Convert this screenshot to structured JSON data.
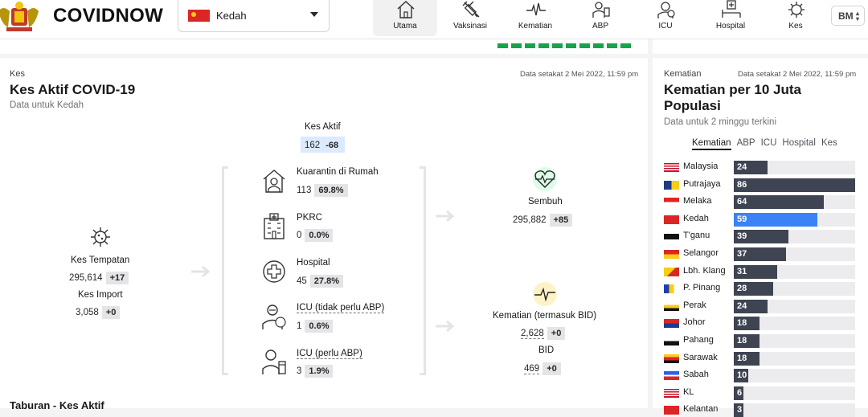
{
  "header": {
    "brand": "COVIDNOW",
    "state": "Kedah",
    "language": "BM",
    "nav": [
      {
        "label": "Utama",
        "icon": "home-icon",
        "active": true
      },
      {
        "label": "Vaksinasi",
        "icon": "syringe-icon",
        "active": false
      },
      {
        "label": "Kematian",
        "icon": "heartbeat-icon",
        "active": false
      },
      {
        "label": "ABP",
        "icon": "ventilator-icon",
        "active": false
      },
      {
        "label": "ICU",
        "icon": "icu-icon",
        "active": false
      },
      {
        "label": "Hospital",
        "icon": "hospital-bed-icon",
        "active": false
      },
      {
        "label": "Kes",
        "icon": "virus-icon",
        "active": false
      }
    ]
  },
  "cases": {
    "eyebrow": "Kes",
    "as_of": "Data setakat 2 Mei 2022, 11:59 pm",
    "title": "Kes Aktif COVID-19",
    "subtitle": "Data untuk Kedah",
    "local": {
      "label": "Kes Tempatan",
      "value": "295,614",
      "delta": "+17"
    },
    "import": {
      "label": "Kes Import",
      "value": "3,058",
      "delta": "+0"
    },
    "active": {
      "label": "Kes Aktif",
      "value": "162",
      "delta": "-68"
    },
    "breakdown": [
      {
        "label": "Kuarantin di Rumah",
        "value": "113",
        "pct": "69.8%",
        "icon": "home-quarantine-icon"
      },
      {
        "label": "PKRC",
        "value": "0",
        "pct": "0.0%",
        "icon": "pkrc-building-icon"
      },
      {
        "label": "Hospital",
        "value": "45",
        "pct": "27.8%",
        "icon": "hospital-cross-icon"
      },
      {
        "label": "ICU (tidak perlu ABP)",
        "value": "1",
        "pct": "0.6%",
        "icon": "icu-patient-icon"
      },
      {
        "label": "ICU (perlu ABP)",
        "value": "3",
        "pct": "1.9%",
        "icon": "ventilator-patient-icon"
      }
    ],
    "recovered": {
      "label": "Sembuh",
      "value": "295,882",
      "delta": "+85"
    },
    "deaths": {
      "label": "Kematian (termasuk BID)",
      "value": "2,628",
      "delta": "+0"
    },
    "bid": {
      "label": "BID",
      "value": "469",
      "delta": "+0"
    },
    "next_section": "Taburan - Kes Aktif"
  },
  "deaths_rank": {
    "eyebrow": "Kematian",
    "as_of": "Data setakat 2 Mei 2022, 11:59 pm",
    "title": "Kematian per 10 Juta Populasi",
    "subtitle": "Data untuk 2 minggu terkini",
    "tabs": [
      "Kematian",
      "ABP",
      "ICU",
      "Hospital",
      "Kes"
    ],
    "max": 86,
    "highlight_color": "#3b82f6",
    "bar_color": "#3f4452",
    "rows": [
      {
        "name": "Malaysia",
        "value": 24
      },
      {
        "name": "Putrajaya",
        "value": 86
      },
      {
        "name": "Melaka",
        "value": 64
      },
      {
        "name": "Kedah",
        "value": 59,
        "highlight": true
      },
      {
        "name": "T'ganu",
        "value": 39
      },
      {
        "name": "Selangor",
        "value": 37
      },
      {
        "name": "Lbh. Klang",
        "value": 31
      },
      {
        "name": "P. Pinang",
        "value": 28
      },
      {
        "name": "Perak",
        "value": 24
      },
      {
        "name": "Johor",
        "value": 18
      },
      {
        "name": "Pahang",
        "value": 18
      },
      {
        "name": "Sarawak",
        "value": 18
      },
      {
        "name": "Sabah",
        "value": 10
      },
      {
        "name": "KL",
        "value": 6
      },
      {
        "name": "Kelantan",
        "value": 3
      }
    ]
  }
}
